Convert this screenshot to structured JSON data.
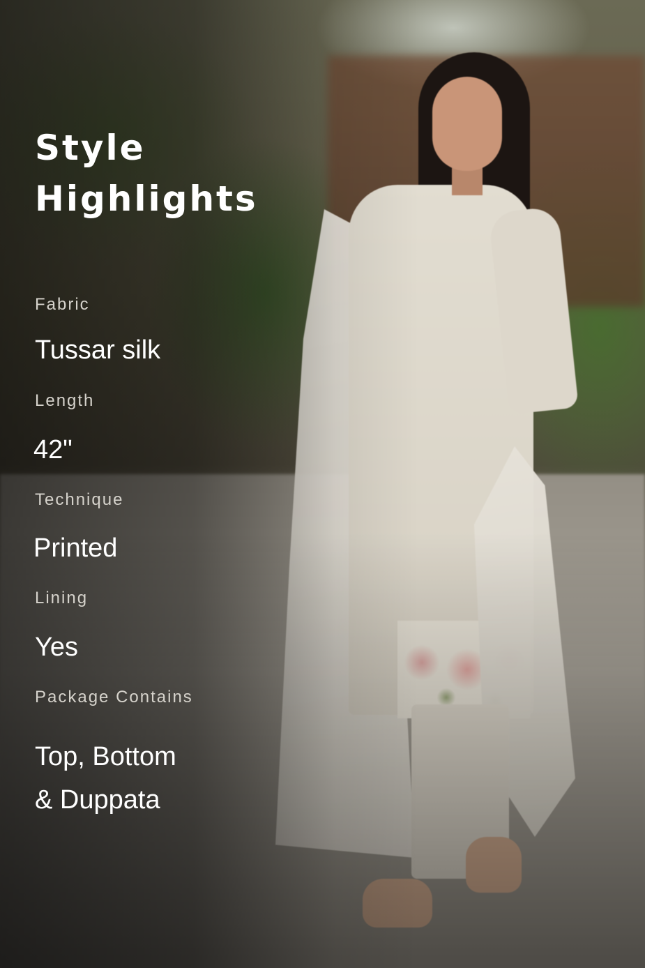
{
  "heading": "Style\nHighlights",
  "specs": [
    {
      "label": "Fabric",
      "value": "Tussar silk"
    },
    {
      "label": "Length",
      "value": "42\""
    },
    {
      "label": "Technique",
      "value": "Printed"
    },
    {
      "label": "Lining",
      "value": "Yes"
    },
    {
      "label": "Package Contains",
      "value": "Top, Bottom\n& Duppata"
    }
  ],
  "colors": {
    "text": "#ffffff",
    "label_text": "#d6d3cc"
  },
  "photo": "model-in-white-kurta-with-floral-print-and-dupatta"
}
